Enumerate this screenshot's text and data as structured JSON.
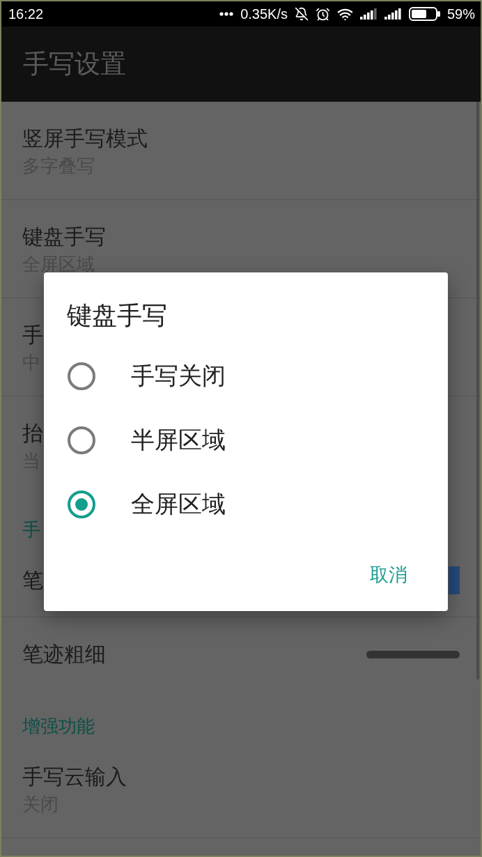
{
  "status_bar": {
    "time": "16:22",
    "network_speed": "0.35K/s",
    "battery": "59%"
  },
  "app_bar": {
    "title": "手写设置"
  },
  "sections": [
    {
      "items": [
        {
          "kind": "summary",
          "title": "竖屏手写模式",
          "summary": "多字叠写"
        },
        {
          "kind": "summary",
          "title": "键盘手写",
          "summary": "全屏区域"
        },
        {
          "kind": "summary",
          "title": "手",
          "summary": "中"
        },
        {
          "kind": "summary",
          "title": "抬",
          "summary": "当"
        }
      ]
    },
    {
      "header": "手",
      "items": [
        {
          "kind": "color",
          "title": "笔",
          "color": "#25497a"
        },
        {
          "kind": "stroke",
          "title": "笔迹粗细"
        }
      ]
    },
    {
      "header": "增强功能",
      "items": [
        {
          "kind": "summary",
          "title": "手写云输入",
          "summary": "关闭"
        }
      ]
    }
  ],
  "dialog": {
    "title": "键盘手写",
    "options": [
      {
        "label": "手写关闭",
        "selected": false
      },
      {
        "label": "半屏区域",
        "selected": false
      },
      {
        "label": "全屏区域",
        "selected": true
      }
    ],
    "buttons": [
      "取消"
    ]
  }
}
